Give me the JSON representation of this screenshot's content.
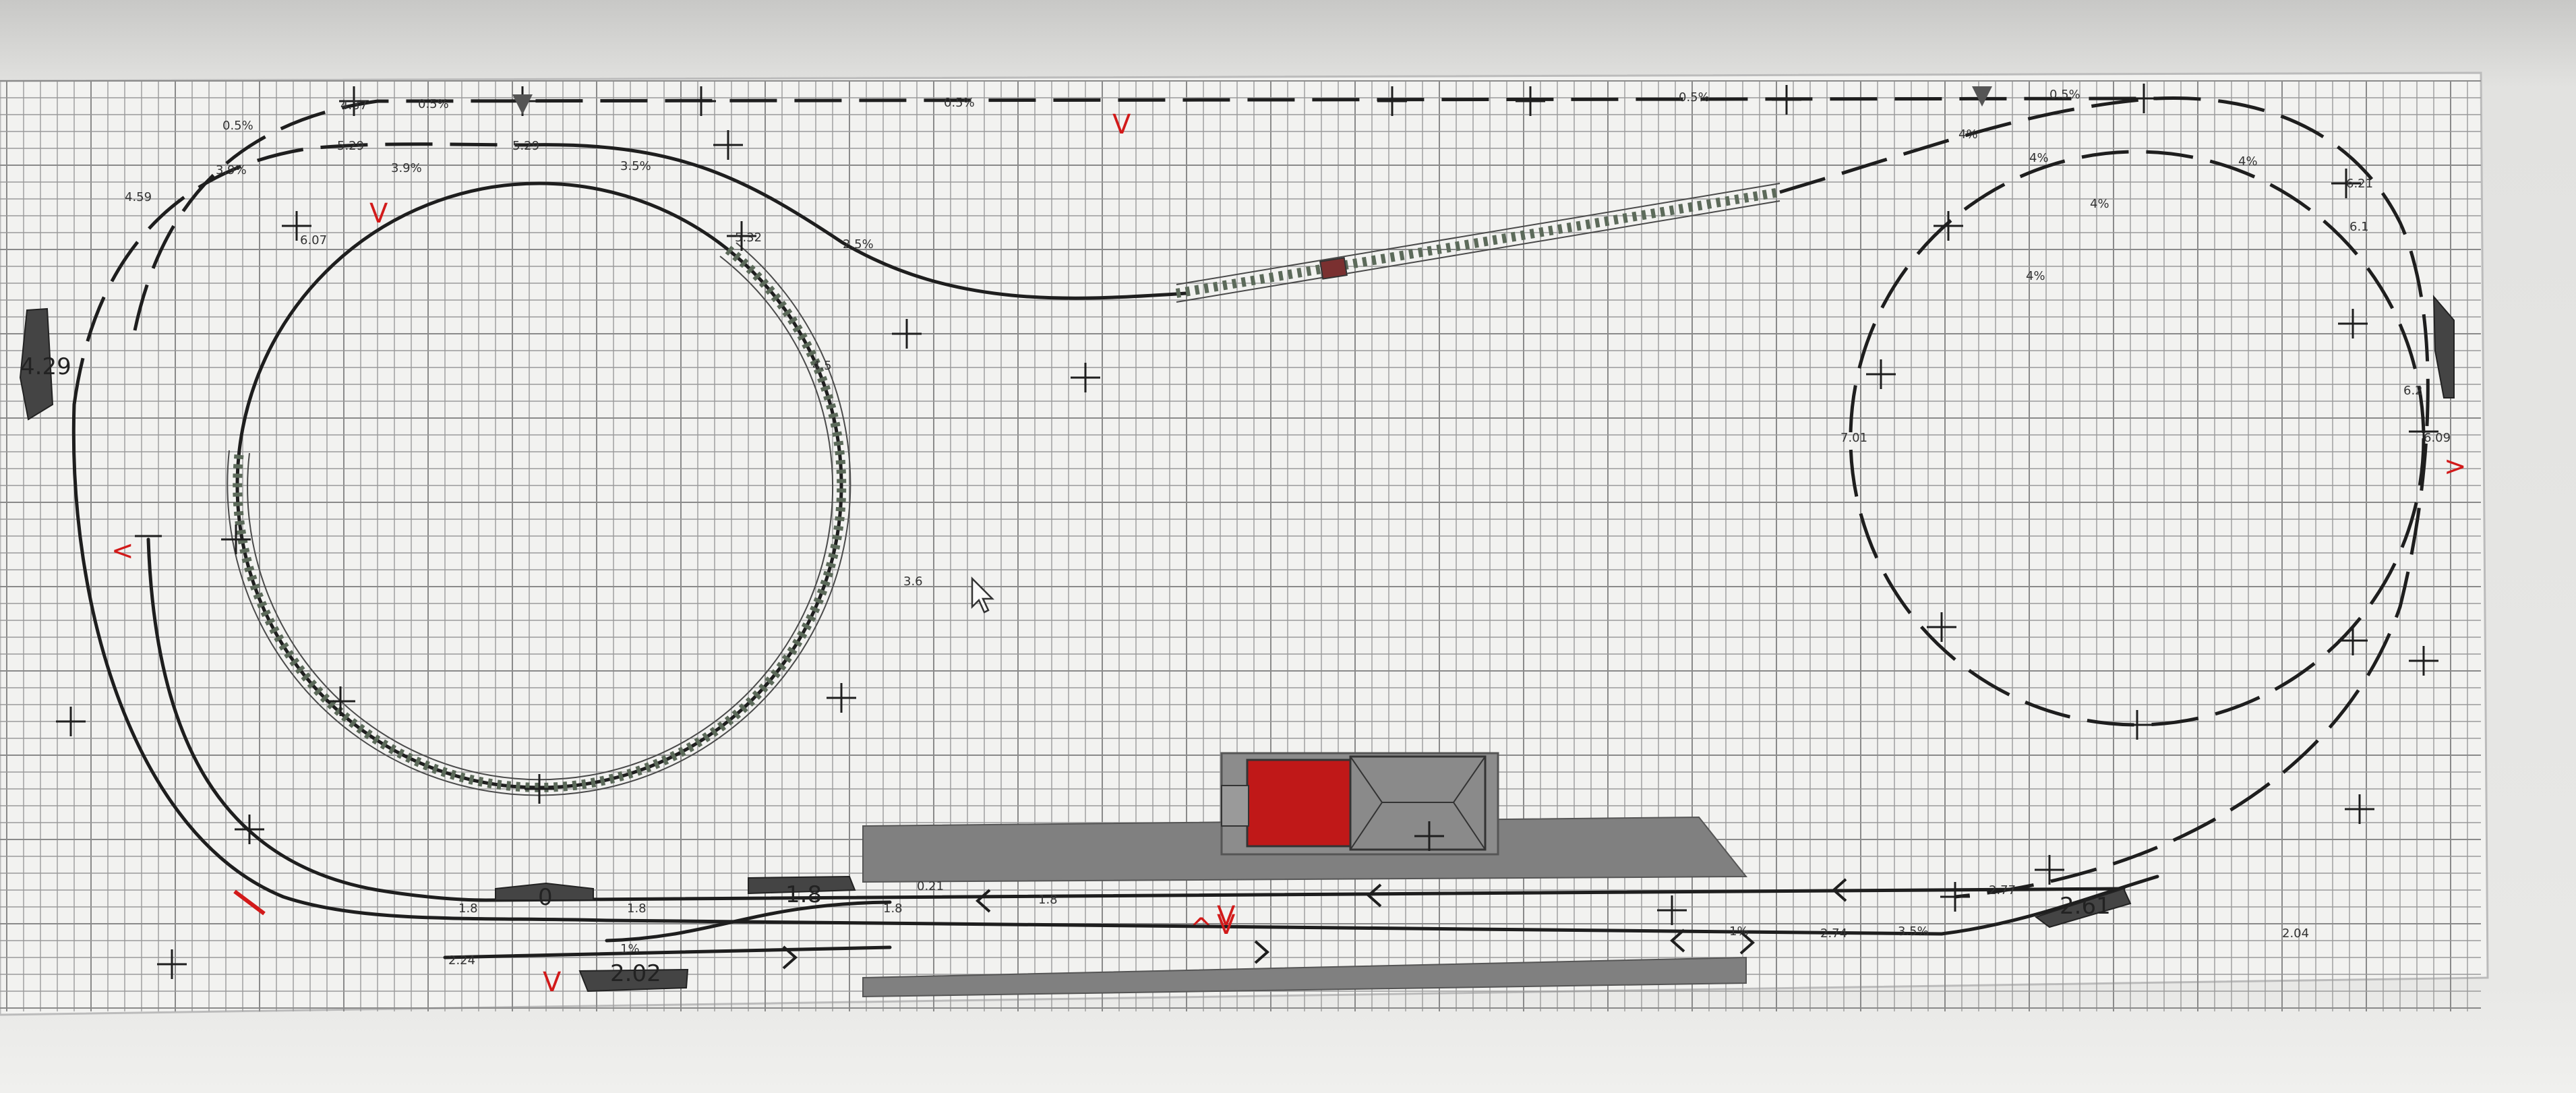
{
  "plan": {
    "grade_labels": [
      "0.5%",
      "0.5%",
      "0.5%",
      "0.5%",
      "0.5%",
      "3.9%",
      "3.9%",
      "3.5%",
      "2.5%",
      "4%",
      "4%",
      "4%",
      "4%",
      "4%",
      "3.5%",
      "1%",
      "1%"
    ],
    "height_labels": [
      "4.37",
      "5.29",
      "5.29",
      "4.59",
      "6.07",
      "5.32",
      "4.5",
      "3.6",
      "0.21",
      "6.21",
      "7.01",
      "6.1",
      "6.2",
      "6.09",
      "2.04",
      "2.24",
      "1.8",
      "1.8",
      "1.8",
      "1.8",
      "2.77",
      "2.74"
    ],
    "tunnel_labels": [
      "4.29",
      "0",
      "1.8",
      "2.02",
      "2.61"
    ],
    "direction_marks": [
      "V",
      "V",
      "<",
      "V",
      "V",
      ">",
      "^",
      "V"
    ]
  },
  "colors": {
    "grid_bg": "#f2f2f0",
    "grid_line": "#9a9a9a",
    "track": "#1e1e1e",
    "truss": "#5c6a5a",
    "platform": "#808080",
    "building_roof_red": "#c01818",
    "building_roof_gray": "#8a8a8a",
    "direction_mark": "#d21a1a"
  }
}
